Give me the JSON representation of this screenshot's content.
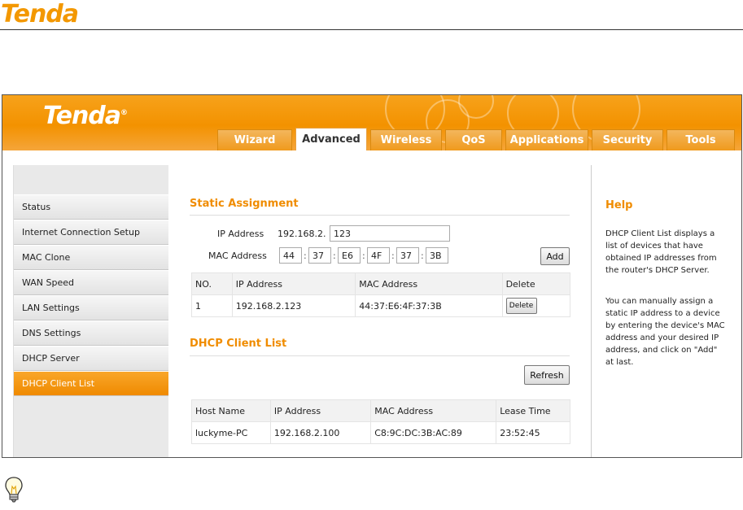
{
  "doc": {
    "logo_text": "Tenda"
  },
  "router": {
    "logo_text": "Tenda",
    "logo_mark": "®",
    "tabs": [
      {
        "label": "Wizard",
        "active": false
      },
      {
        "label": "Advanced",
        "active": true
      },
      {
        "label": "Wireless",
        "active": false
      },
      {
        "label": "QoS",
        "active": false
      },
      {
        "label": "Applications",
        "active": false
      },
      {
        "label": "Security",
        "active": false
      },
      {
        "label": "Tools",
        "active": false
      }
    ],
    "sidebar": [
      {
        "label": "Status"
      },
      {
        "label": "Internet Connection Setup"
      },
      {
        "label": "MAC Clone"
      },
      {
        "label": "WAN Speed"
      },
      {
        "label": "LAN Settings"
      },
      {
        "label": "DNS Settings"
      },
      {
        "label": "DHCP Server"
      },
      {
        "label": "DHCP Client List",
        "active": true
      }
    ]
  },
  "static": {
    "title": "Static Assignment",
    "ip_label": "IP Address",
    "ip_prefix": "192.168.2.",
    "ip_value": "123",
    "mac_label": "MAC Address",
    "mac_parts": [
      "44",
      "37",
      "E6",
      "4F",
      "37",
      "3B"
    ],
    "add_label": "Add",
    "table": {
      "headers": [
        "NO.",
        "IP Address",
        "MAC Address",
        "Delete"
      ],
      "rows": [
        [
          "1",
          "192.168.2.123",
          "44:37:E6:4F:37:3B"
        ]
      ],
      "delete_label": "Delete"
    }
  },
  "clients": {
    "title": "DHCP Client List",
    "refresh_label": "Refresh",
    "table": {
      "headers": [
        "Host Name",
        "IP Address",
        "MAC Address",
        "Lease Time"
      ],
      "rows": [
        [
          "luckyme-PC",
          "192.168.2.100",
          "C8:9C:DC:3B:AC:89",
          "23:52:45"
        ]
      ]
    }
  },
  "help": {
    "title": "Help",
    "p1": "DHCP Client List displays a list of devices that have obtained IP addresses from the router's DHCP Server.",
    "p2": "You can manually assign a static IP address to a device by entering the device's MAC address and your desired IP address, and click on \"Add\" at last."
  },
  "tip_icon": "lightbulb-icon",
  "accent_color": "#f39200"
}
